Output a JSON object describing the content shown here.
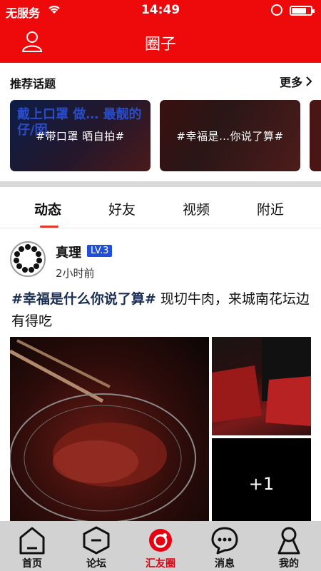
{
  "status_bar": {
    "carrier": "无服务",
    "time": "14:49"
  },
  "header": {
    "title": "圈子"
  },
  "topics": {
    "section_title": "推荐话题",
    "more_label": "更多",
    "cards": [
      {
        "label": "#带口罩 晒自拍#",
        "overlay_text": "戴上口罩 做… 最靓的仔/囡"
      },
      {
        "label": "#幸福是…你说了算#"
      }
    ]
  },
  "tabs": [
    {
      "label": "动态",
      "active": true
    },
    {
      "label": "好友"
    },
    {
      "label": "视频"
    },
    {
      "label": "附近"
    }
  ],
  "post": {
    "author": "真理",
    "level": "LV.3",
    "time_ago": "2小时前",
    "hashtag": "#幸福是什么你说了算#",
    "text": " 现切牛肉，来城南花坛边有得吃",
    "extra_images": "+1"
  },
  "bottom_nav": {
    "items": [
      {
        "label": "首页",
        "icon": "home-icon"
      },
      {
        "label": "论坛",
        "icon": "forum-icon"
      },
      {
        "label": "汇友圈",
        "icon": "circle-icon",
        "active": true
      },
      {
        "label": "消息",
        "icon": "message-icon"
      },
      {
        "label": "我的",
        "icon": "profile-icon"
      }
    ]
  },
  "colors": {
    "brand_red": "#ee0a0a",
    "level_badge": "#1f4fd6",
    "tab_indicator": "#e03a2c",
    "nav_active": "#e60012"
  }
}
